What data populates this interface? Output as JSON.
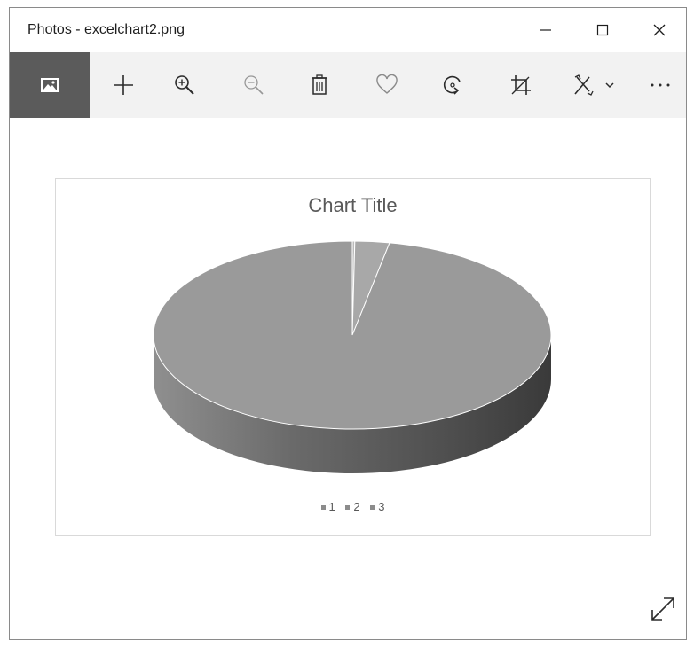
{
  "window": {
    "title": "Photos - excelchart2.png",
    "minimize_icon": "minimize-icon",
    "maximize_icon": "maximize-icon",
    "close_icon": "close-icon"
  },
  "toolbar": {
    "items": [
      {
        "name": "photo-icon",
        "active": true
      },
      {
        "name": "add-icon"
      },
      {
        "name": "zoom-in-icon"
      },
      {
        "name": "zoom-out-icon",
        "disabled": true
      },
      {
        "name": "delete-icon"
      },
      {
        "name": "favorite-icon"
      },
      {
        "name": "rotate-icon"
      },
      {
        "name": "crop-icon"
      },
      {
        "name": "edit-icon"
      },
      {
        "name": "more-icon"
      }
    ]
  },
  "chart_data": {
    "type": "pie",
    "title": "Chart Title",
    "categories": [
      "1",
      "2",
      "3"
    ],
    "values": [
      0.2,
      2.8,
      97
    ],
    "colors": [
      "#bcbcbc",
      "#a8a8a8",
      "#9a9a9a"
    ],
    "style": "3d",
    "legend_position": "bottom"
  },
  "footer": {
    "expand_icon": "expand-icon"
  }
}
